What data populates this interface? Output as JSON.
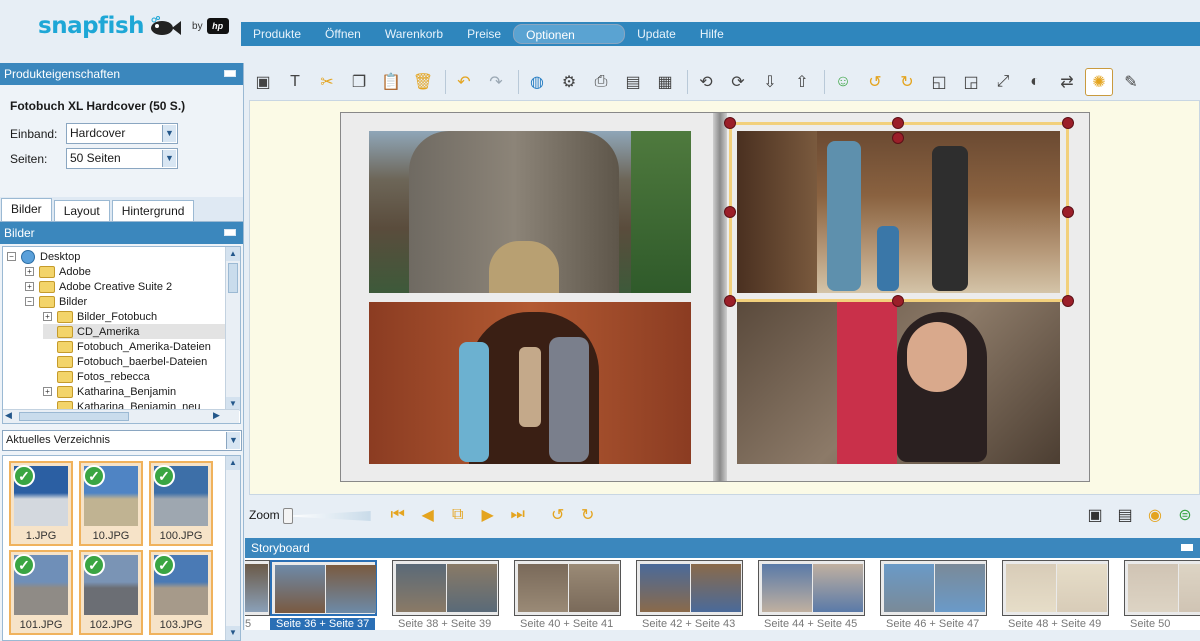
{
  "header": {
    "logo_text": "snapfish",
    "by_text": "by",
    "hp_text": "hp",
    "menu": [
      "Produkte",
      "Öffnen",
      "Warenkorb",
      "Preise",
      "Optionen",
      "Update",
      "Hilfe"
    ],
    "menu_selected": "Optionen"
  },
  "props_panel": {
    "title": "Produkteigenschaften",
    "product": "Fotobuch XL Hardcover (50 S.)",
    "einband_label": "Einband:",
    "einband_value": "Hardcover",
    "seiten_label": "Seiten:",
    "seiten_value": "50 Seiten"
  },
  "tabs": [
    "Bilder",
    "Layout",
    "Hintergrund"
  ],
  "bilder_panel": {
    "title": "Bilder",
    "tree": [
      {
        "label": "Desktop",
        "type": "desktop",
        "level": 0,
        "expander": "⊟"
      },
      {
        "label": "Adobe",
        "type": "folder",
        "level": 1,
        "expander": "⊞"
      },
      {
        "label": "Adobe Creative Suite 2",
        "type": "folder",
        "level": 1,
        "expander": "⊞"
      },
      {
        "label": "Bilder",
        "type": "folder",
        "level": 1,
        "expander": "⊟"
      },
      {
        "label": "Bilder_Fotobuch",
        "type": "folder",
        "level": 2,
        "expander": "⊞"
      },
      {
        "label": "CD_Amerika",
        "type": "folder",
        "level": 2,
        "expander": "",
        "selected": true
      },
      {
        "label": "Fotobuch_Amerika-Dateien",
        "type": "folder",
        "level": 2,
        "expander": ""
      },
      {
        "label": "Fotobuch_baerbel-Dateien",
        "type": "folder",
        "level": 2,
        "expander": ""
      },
      {
        "label": "Fotos_rebecca",
        "type": "folder",
        "level": 2,
        "expander": ""
      },
      {
        "label": "Katharina_Benjamin",
        "type": "folder",
        "level": 2,
        "expander": "⊞"
      },
      {
        "label": "Katharina_Benjamin_neu",
        "type": "folder",
        "level": 2,
        "expander": ""
      }
    ],
    "dir_select": "Aktuelles Verzeichnis",
    "thumbnails": [
      "1.JPG",
      "10.JPG",
      "100.JPG",
      "101.JPG",
      "102.JPG",
      "103.JPG"
    ]
  },
  "toolbar": {
    "icons": [
      "frame-icon",
      "text-icon",
      "cut-icon",
      "copy-icon",
      "paste-icon",
      "delete-icon",
      "undo-icon",
      "redo-icon",
      "globe-icon",
      "page-settings-icon",
      "print-icon",
      "layout-icon",
      "grid-icon",
      "rotate-left-image-icon",
      "rotate-right-image-icon",
      "send-back-icon",
      "bring-front-icon",
      "smiley-icon",
      "rotate-ccw-icon",
      "rotate-cw-icon",
      "speech-left-icon",
      "speech-right-icon",
      "resize-icon",
      "fill-icon",
      "replace-icon",
      "settings-active-icon",
      "edit-icon"
    ]
  },
  "zoom": {
    "label": "Zoom",
    "level": 0.0
  },
  "storyboard": {
    "title": "Storyboard",
    "pages": [
      {
        "label": "5",
        "active": false
      },
      {
        "label": "Seite 36 + Seite 37",
        "active": true
      },
      {
        "label": "Seite 38 + Seite 39",
        "active": false
      },
      {
        "label": "Seite 40 + Seite 41",
        "active": false
      },
      {
        "label": "Seite 42 + Seite 43",
        "active": false
      },
      {
        "label": "Seite 44 + Seite 45",
        "active": false
      },
      {
        "label": "Seite 46 + Seite 47",
        "active": false
      },
      {
        "label": "Seite 48 + Seite 49",
        "active": false
      },
      {
        "label": "Seite 50",
        "active": false
      }
    ]
  },
  "colors": {
    "menubar": "#2f86bd",
    "panel_header": "#3b87bd",
    "accent_orange": "#e4a41f",
    "handle": "#9b1f29",
    "selection": "#f2d07c"
  }
}
